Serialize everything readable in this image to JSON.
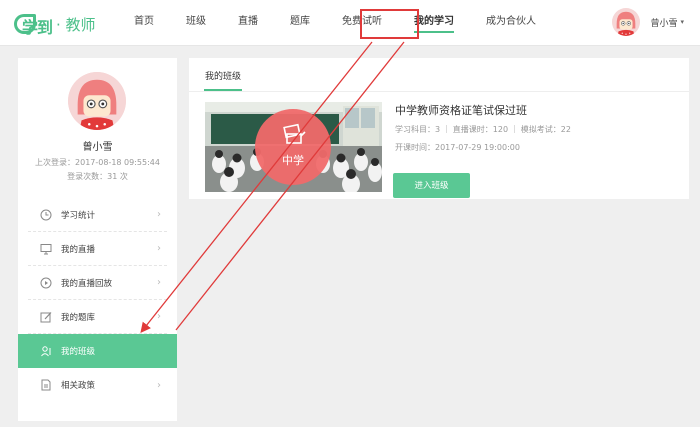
{
  "header": {
    "logo_text": "学到",
    "logo_sub": "· 教师",
    "nav": [
      {
        "label": "首页"
      },
      {
        "label": "班级"
      },
      {
        "label": "直播"
      },
      {
        "label": "题库"
      },
      {
        "label": "免费试听"
      },
      {
        "label": "我的学习",
        "active": true
      },
      {
        "label": "成为合伙人"
      }
    ],
    "user_name": "曾小雪",
    "caret": "▾"
  },
  "sidebar": {
    "name": "曾小雪",
    "last_login": "上次登录：2017-08-18 09:55:44",
    "login_count": "登录次数：31 次",
    "menu": [
      {
        "label": "学习统计",
        "icon": "clock-icon"
      },
      {
        "label": "我的直播",
        "icon": "monitor-icon"
      },
      {
        "label": "我的直播回放",
        "icon": "play-icon"
      },
      {
        "label": "我的题库",
        "icon": "edit-icon"
      },
      {
        "label": "我的班级",
        "icon": "user-card-icon",
        "active": true
      },
      {
        "label": "相关政策",
        "icon": "document-icon"
      }
    ]
  },
  "main": {
    "tab": "我的班级",
    "course": {
      "badge": "中学",
      "title": "中学教师资格证笔试保过班",
      "subjects": "学习科目：3",
      "lessons": "直播课时：120",
      "exams": "模拟考试：22",
      "start_time": "开课时间：2017-07-29 19:00:00",
      "enter_label": "进入班级"
    }
  },
  "colors": {
    "brand": "#4cc08a",
    "accent": "#5ac894",
    "annotation": "#e03a3a",
    "badge": "#f06a6a"
  }
}
